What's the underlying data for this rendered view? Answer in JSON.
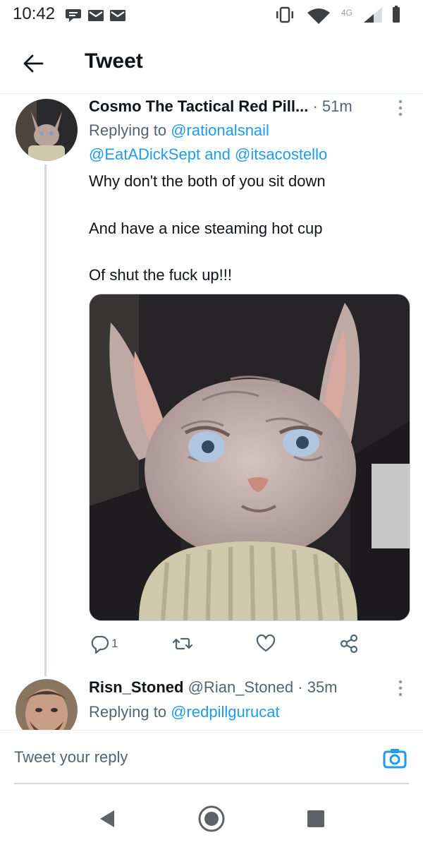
{
  "status_bar": {
    "time": "10:42",
    "network": "4G",
    "left_icons": [
      "chat-icon",
      "mail-icon",
      "mail-icon"
    ],
    "right_icons": [
      "vibrate-icon",
      "wifi-icon",
      "signal-icon",
      "battery-icon"
    ]
  },
  "header": {
    "title": "Tweet",
    "back_icon": "arrow-left-icon"
  },
  "tweets": [
    {
      "display_name": "Cosmo The Tactical Red Pill...",
      "time_ago": "· 51m",
      "replying_prefix": "Replying to",
      "mention_1": "@rationalsnail",
      "mention_2": "@EatADickSept",
      "and_word": "and",
      "mention_3": "@itsacostello",
      "text_line_1": "Why don't the both of you sit down",
      "text_line_2": "And have a nice steaming hot cup",
      "text_line_3": "Of shut the fuck up!!!",
      "reply_count": "1",
      "actions": [
        "reply-icon",
        "retweet-icon",
        "like-icon",
        "share-icon"
      ]
    },
    {
      "display_name": "Risn_Stoned",
      "handle": "@Rian_Stoned",
      "time_ago": "· 35m",
      "replying_prefix": "Replying to",
      "mention_1": "@redpillgurucat"
    }
  ],
  "compose": {
    "placeholder": "Tweet your reply",
    "camera_icon": "camera-icon"
  },
  "nav_bar": [
    "back-triangle-icon",
    "home-circle-icon",
    "recents-square-icon"
  ],
  "colors": {
    "accent": "#1d9bf0",
    "text_primary": "#0f1419",
    "text_secondary": "#536471",
    "divider": "#e6ecf0"
  }
}
